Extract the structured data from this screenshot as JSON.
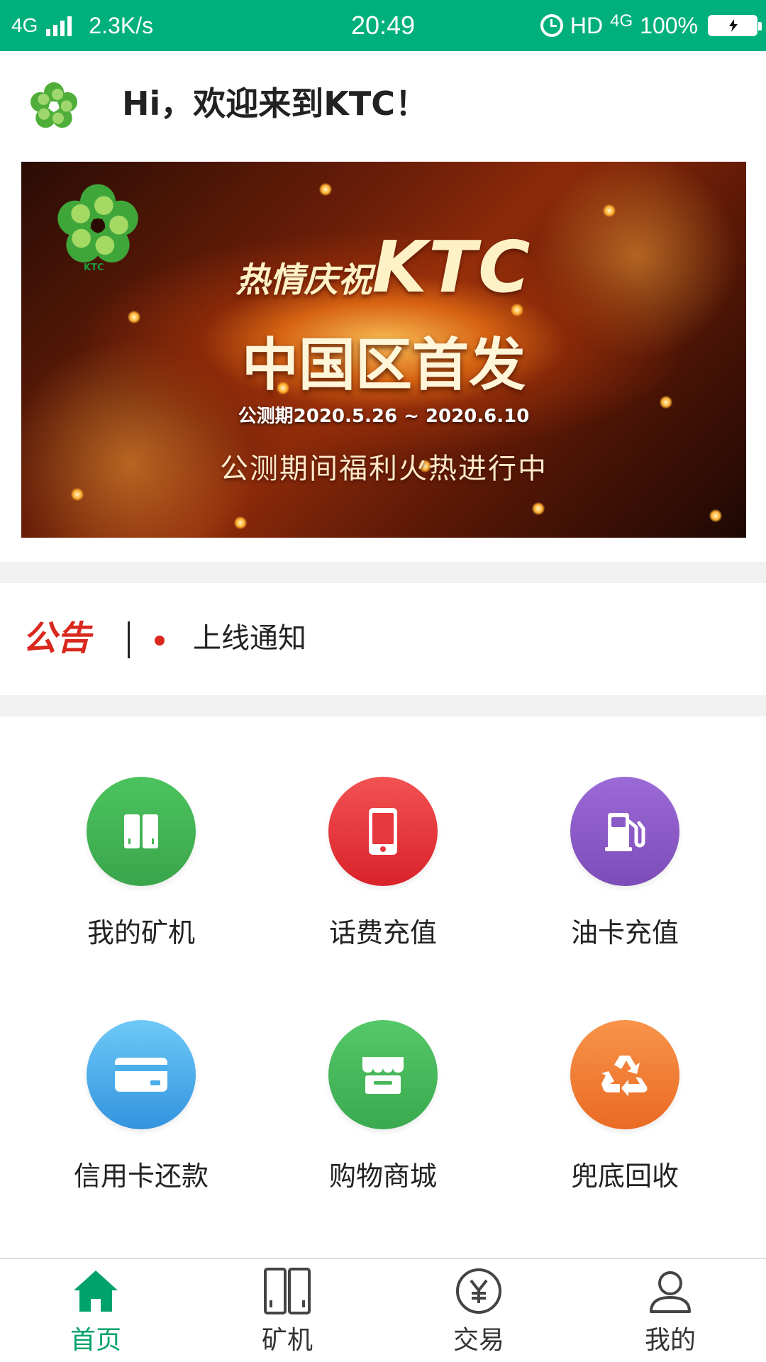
{
  "status_bar": {
    "network": "4G",
    "speed": "2.3K/s",
    "time": "20:49",
    "hd": "HD",
    "network2": "4G",
    "battery": "100%"
  },
  "header": {
    "welcome": "Hi，欢迎来到KTC！"
  },
  "banner": {
    "logo_text": "KTC",
    "line1_cn": "热情庆祝",
    "line1_brand": "KTC",
    "line2": "中国区首发",
    "line3": "公测期2020.5.26 ~ 2020.6.10",
    "line4": "公测期间福利火热进行中"
  },
  "notice": {
    "label": "公告",
    "text": "上线通知"
  },
  "services": [
    {
      "label": "我的矿机",
      "icon": "miner-icon",
      "color": "#43b556"
    },
    {
      "label": "话费充值",
      "icon": "phone-icon",
      "color": "#e7383d"
    },
    {
      "label": "油卡充值",
      "icon": "fuel-pump-icon",
      "color": "#8a5bc6"
    },
    {
      "label": "信用卡还款",
      "icon": "credit-card-icon",
      "color": "#4aaeea"
    },
    {
      "label": "购物商城",
      "icon": "shop-icon",
      "color": "#47b85b"
    },
    {
      "label": "兜底回收",
      "icon": "recycle-icon",
      "color": "#f07e35"
    }
  ],
  "tabbar": {
    "active_color": "#00a26b",
    "items": [
      {
        "label": "首页",
        "icon": "home-icon"
      },
      {
        "label": "矿机",
        "icon": "miner-icon"
      },
      {
        "label": "交易",
        "icon": "yen-icon"
      },
      {
        "label": "我的",
        "icon": "user-icon"
      }
    ]
  }
}
